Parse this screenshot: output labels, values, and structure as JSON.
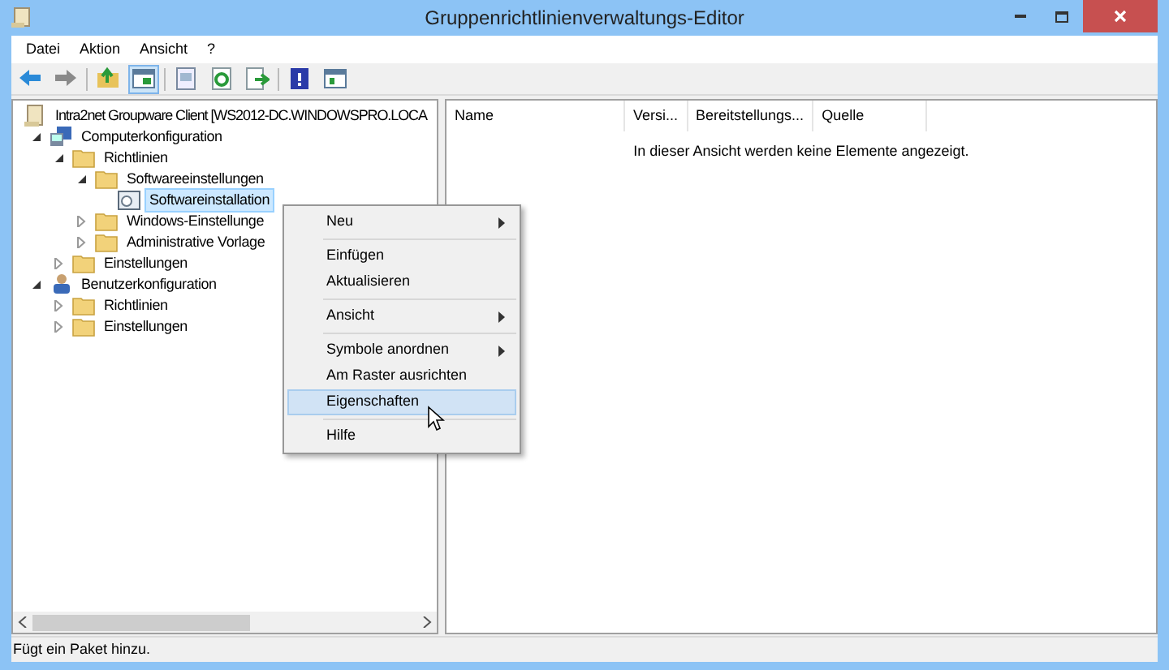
{
  "window": {
    "title": "Gruppenrichtlinienverwaltungs-Editor"
  },
  "menu_bar": [
    "Datei",
    "Aktion",
    "Ansicht",
    "?"
  ],
  "toolbar": [
    {
      "kind": "back",
      "selected": false
    },
    {
      "kind": "forward",
      "selected": false
    },
    {
      "kind": "up",
      "selected": false
    },
    {
      "kind": "pane",
      "selected": true
    },
    {
      "kind": "props",
      "selected": false
    },
    {
      "kind": "refresh",
      "selected": false
    },
    {
      "kind": "export",
      "selected": false
    },
    {
      "kind": "help",
      "selected": false
    },
    {
      "kind": "view",
      "selected": false
    }
  ],
  "tree": [
    {
      "label": "Intra2net Groupware Client [WS2012-DC.WINDOWSPRO.LOCA",
      "kind": "policy",
      "selected": false,
      "children": [
        {
          "label": "Computerkonfiguration",
          "kind": "computer",
          "selected": false,
          "expanded": true,
          "children": [
            {
              "label": "Richtlinien",
              "kind": "folder",
              "selected": false,
              "expanded": true,
              "children": [
                {
                  "label": "Softwareeinstellungen",
                  "kind": "folder",
                  "selected": false,
                  "expanded": true,
                  "children": [
                    {
                      "label": "Softwareinstallation",
                      "kind": "install",
                      "selected": true
                    }
                  ]
                },
                {
                  "label": "Windows-Einstellunge",
                  "kind": "folder",
                  "selected": false,
                  "expanded": false
                },
                {
                  "label": "Administrative Vorlage",
                  "kind": "folder",
                  "selected": false,
                  "expanded": false
                }
              ]
            },
            {
              "label": "Einstellungen",
              "kind": "folder",
              "selected": false,
              "expanded": false
            }
          ]
        },
        {
          "label": "Benutzerkonfiguration",
          "kind": "user",
          "selected": false,
          "expanded": true,
          "children": [
            {
              "label": "Richtlinien",
              "kind": "folder",
              "selected": false,
              "expanded": false
            },
            {
              "label": "Einstellungen",
              "kind": "folder",
              "selected": false,
              "expanded": false
            }
          ]
        }
      ]
    }
  ],
  "table": {
    "columns": [
      "Name",
      "Versi...",
      "Bereitstellungs...",
      "Quelle"
    ],
    "empty_message": "In dieser Ansicht werden keine Elemente angezeigt."
  },
  "context_menu": [
    {
      "kind": "item",
      "label": "Neu",
      "submenu": true,
      "selected": false
    },
    {
      "kind": "separator"
    },
    {
      "kind": "item",
      "label": "Einfügen",
      "submenu": false,
      "selected": false
    },
    {
      "kind": "item",
      "label": "Aktualisieren",
      "submenu": false,
      "selected": false
    },
    {
      "kind": "separator"
    },
    {
      "kind": "item",
      "label": "Ansicht",
      "submenu": true,
      "selected": false
    },
    {
      "kind": "separator"
    },
    {
      "kind": "item",
      "label": "Symbole anordnen",
      "submenu": true,
      "selected": false
    },
    {
      "kind": "item",
      "label": "Am Raster ausrichten",
      "submenu": false,
      "selected": false
    },
    {
      "kind": "item",
      "label": "Eigenschaften",
      "submenu": false,
      "selected": true
    },
    {
      "kind": "separator"
    },
    {
      "kind": "item",
      "label": "Hilfe",
      "submenu": false,
      "selected": false
    }
  ],
  "status_bar": "Fügt ein Paket hinzu."
}
